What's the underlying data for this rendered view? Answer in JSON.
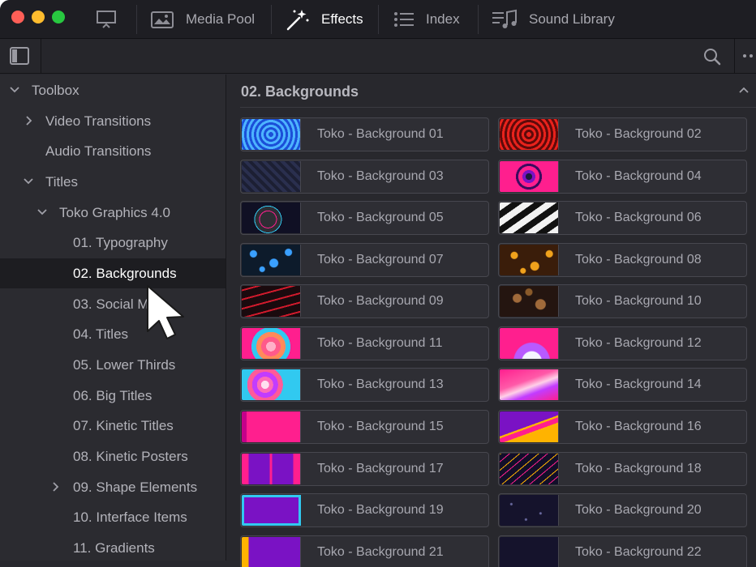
{
  "titlebar": {
    "tabs": [
      {
        "label": "",
        "icon": "monitor-icon"
      },
      {
        "label": "Media Pool",
        "icon": "media-pool-icon"
      },
      {
        "label": "Effects",
        "icon": "magic-wand-icon",
        "active": true
      },
      {
        "label": "Index",
        "icon": "list-icon"
      },
      {
        "label": "Sound Library",
        "icon": "music-note-icon"
      }
    ]
  },
  "toolbar": {
    "left_icon": "sidebar-toggle-icon",
    "right_icons": [
      "search-icon",
      "more-options-icon"
    ]
  },
  "sidebar": {
    "items": [
      {
        "label": "Toolbox",
        "chevron": "down"
      },
      {
        "label": "Video Transitions",
        "chevron": "right"
      },
      {
        "label": "Audio Transitions",
        "chevron": ""
      },
      {
        "label": "Titles",
        "chevron": "down"
      },
      {
        "label": "Toko Graphics 4.0",
        "chevron": "down"
      },
      {
        "label": "01. Typography",
        "chevron": ""
      },
      {
        "label": "02. Backgrounds",
        "chevron": "",
        "selected": true
      },
      {
        "label": "03. Social M",
        "chevron": ""
      },
      {
        "label": "04. Titles",
        "chevron": ""
      },
      {
        "label": "05. Lower Thirds",
        "chevron": ""
      },
      {
        "label": "06. Big Titles",
        "chevron": ""
      },
      {
        "label": "07. Kinetic Titles",
        "chevron": ""
      },
      {
        "label": "08. Kinetic Posters",
        "chevron": ""
      },
      {
        "label": "09. Shape Elements",
        "chevron": "right"
      },
      {
        "label": "10. Interface Items",
        "chevron": ""
      },
      {
        "label": "11. Gradients",
        "chevron": ""
      }
    ]
  },
  "content": {
    "section_title": "02. Backgrounds",
    "items": [
      "Toko - Background 01",
      "Toko - Background 02",
      "Toko - Background 03",
      "Toko - Background 04",
      "Toko - Background 05",
      "Toko - Background 06",
      "Toko - Background 07",
      "Toko - Background 08",
      "Toko - Background 09",
      "Toko - Background 10",
      "Toko - Background 11",
      "Toko - Background 12",
      "Toko - Background 13",
      "Toko - Background 14",
      "Toko - Background 15",
      "Toko - Background 16",
      "Toko - Background 17",
      "Toko - Background 18",
      "Toko - Background 19",
      "Toko - Background 20",
      "Toko - Background 21",
      "Toko - Background 22"
    ]
  },
  "colors": {
    "window_bg": "#28282e",
    "selected_row": "#1d1d21",
    "accent_pink": "#ff1f8e",
    "accent_purple": "#7a12c4",
    "accent_yellow": "#ffb300",
    "accent_cyan": "#31c9f0"
  }
}
